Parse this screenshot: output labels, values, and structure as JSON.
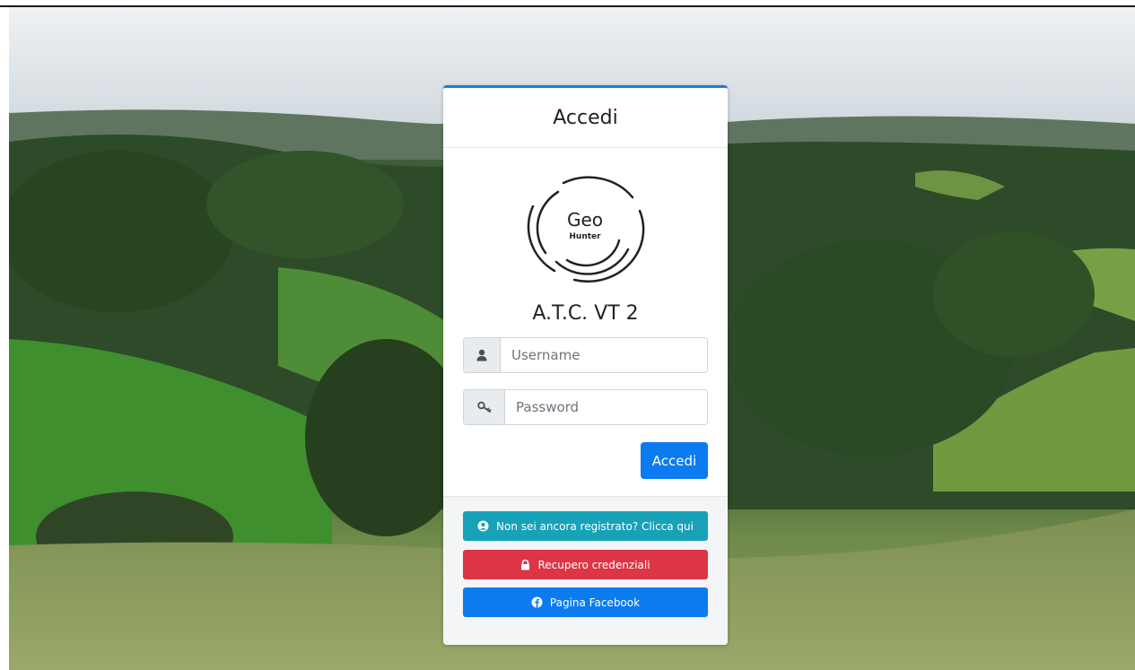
{
  "login": {
    "title": "Accedi",
    "logo_text_main": "Geo",
    "logo_text_sub": "Hunter",
    "org_name": "A.T.C. VT 2",
    "username_placeholder": "Username",
    "password_placeholder": "Password",
    "submit_label": "Accedi"
  },
  "footer": {
    "register_label": "Non sei ancora registrato? Clicca qui",
    "recover_label": "Recupero credenziali",
    "facebook_label": "Pagina Facebook"
  },
  "icons": {
    "username": "user-icon",
    "password": "key-icon",
    "register": "user-circle-icon",
    "recover": "lock-icon",
    "facebook": "facebook-icon"
  },
  "colors": {
    "primary": "#0d7bf0",
    "info": "#17a2b8",
    "danger": "#dc3545",
    "card_accent": "#1f7ae0"
  }
}
